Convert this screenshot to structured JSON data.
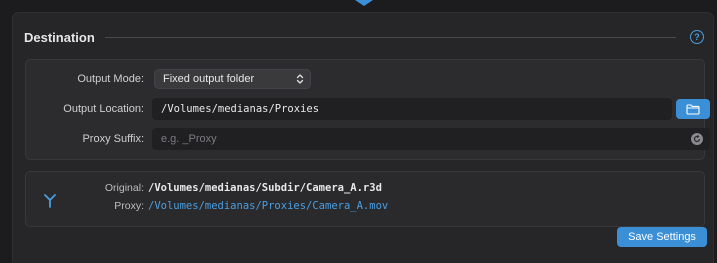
{
  "section": {
    "title": "Destination",
    "help_icon": "question-circle-icon",
    "help_glyph": "?"
  },
  "settings": {
    "output_mode": {
      "label": "Output Mode:",
      "value": "Fixed output folder",
      "icon": "chevron-updown-icon"
    },
    "output_location": {
      "label": "Output Location:",
      "value": "/Volumes/medianas/Proxies",
      "button_icon": "folder-icon"
    },
    "proxy_suffix": {
      "label": "Proxy Suffix:",
      "value": "",
      "placeholder": "e.g. _Proxy",
      "reset_icon": "reset-icon"
    }
  },
  "preview": {
    "icon": "branch-icon",
    "original_label": "Original:",
    "original_value": "/Volumes/medianas/Subdir/Camera_A.r3d",
    "proxy_label": "Proxy:",
    "proxy_value": "/Volumes/medianas/Proxies/Camera_A.mov"
  },
  "actions": {
    "save_label": "Save Settings"
  },
  "colors": {
    "accent": "#3a8fd6",
    "link": "#4a9ee0",
    "background": "#1c1c1e",
    "panel": "#262628"
  }
}
